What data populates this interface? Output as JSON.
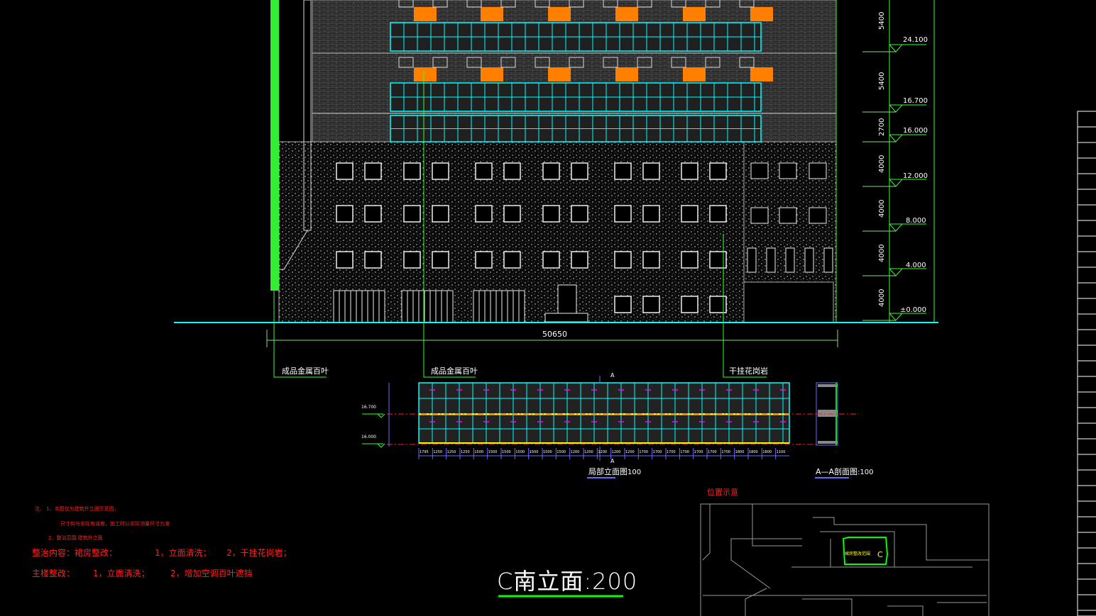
{
  "drawing": {
    "title": "C南立面:200",
    "overall_dimension": "50650",
    "levels": [
      "24.100",
      "16.700",
      "16.000",
      "12.000",
      "8.000",
      "4.000",
      "±0.000"
    ],
    "level_dims": [
      "5400",
      "5400",
      "2700",
      "4000",
      "4000",
      "4000",
      "4000"
    ],
    "callouts": {
      "louver_left": "成品金属百叶",
      "louver_mid": "成品金属百叶",
      "granite": "干挂花岗岩"
    },
    "detail": {
      "title": "局部立面图",
      "title_scale": "100",
      "section_title": "A—A剖面图",
      "section_scale": ":100",
      "section_mark": "A",
      "left_levels": [
        "16.700",
        "16.000"
      ],
      "bottom_dims": [
        "1795",
        "1250",
        "1250",
        "1250",
        "1500",
        "1500",
        "1500",
        "1500",
        "1500",
        "1500",
        "1500",
        "1200",
        "1200",
        "1200",
        "1200",
        "1200",
        "1700",
        "1700",
        "1700",
        "1700",
        "1700",
        "1700",
        "1700",
        "1800",
        "1800",
        "1800",
        "1100"
      ]
    },
    "notes": {
      "line1": "注、 1、本图仅为建筑外立面示意图，",
      "line2": "尺寸和与实际有误差，施工时以实际测量尺寸为准",
      "line3": "2、整治范围  建筑外立面",
      "content_label": "整治内容：裙房整改：",
      "content_item1": "1，立面清洗；",
      "content_item2": "2，干挂花岗岩；",
      "main_label": "主楼整改：",
      "main_item1": "1，立面清洗；",
      "main_item2": "2，增加空调百叶遮挡"
    },
    "location": {
      "title": "位置示意",
      "site_label": "裙房整改范围",
      "site_mark": "C"
    }
  },
  "colors": {
    "background": "#000000",
    "outline": "#00ff00",
    "glass": "#00ffff",
    "louver": "#ff8000",
    "notes": "#ff0000",
    "text": "#ffffff"
  }
}
